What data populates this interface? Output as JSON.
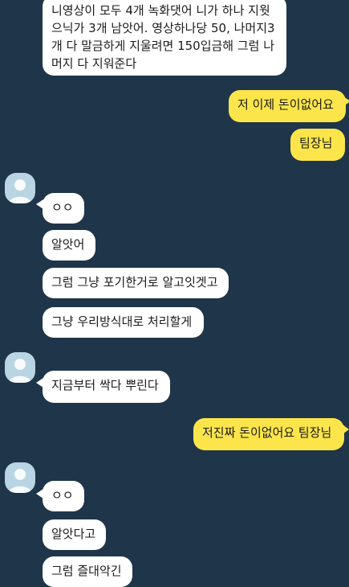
{
  "chat": {
    "messages": [
      {
        "side": "in",
        "text": "니영상이 모두 4개 녹화댓어 니가 하나 지웟\n으닉가 3개 남앗어. 영상하나당 50, 나머지3\n개 다 말금하게 지울려면 150입금해 그럼 나\n머지 다 지워준다"
      },
      {
        "side": "out",
        "text": "저 이제 돈이없어요"
      },
      {
        "side": "out",
        "text": "팀장님"
      },
      {
        "side": "in",
        "text": "ㅇㅇ"
      },
      {
        "side": "in",
        "text": "알앗어"
      },
      {
        "side": "in",
        "text": "그럼 그냥 포기한거로 알고잇겟고"
      },
      {
        "side": "in",
        "text": "그냥 우리방식대로 처리할게"
      },
      {
        "side": "in",
        "text": "지금부터 싹다 뿌린다"
      },
      {
        "side": "out",
        "text": "저진짜 돈이없어요 팀장님"
      },
      {
        "side": "in",
        "text": "ㅇㅇ"
      },
      {
        "side": "in",
        "text": "알앗다고"
      },
      {
        "side": "in",
        "text": "그럼 즐대악긴"
      }
    ]
  },
  "colors": {
    "background": "#1f3549",
    "incoming_bubble": "#ffffff",
    "outgoing_bubble": "#fbe54a",
    "avatar": "#b9d4e3"
  },
  "icons": {
    "avatar": "person-avatar-icon"
  }
}
